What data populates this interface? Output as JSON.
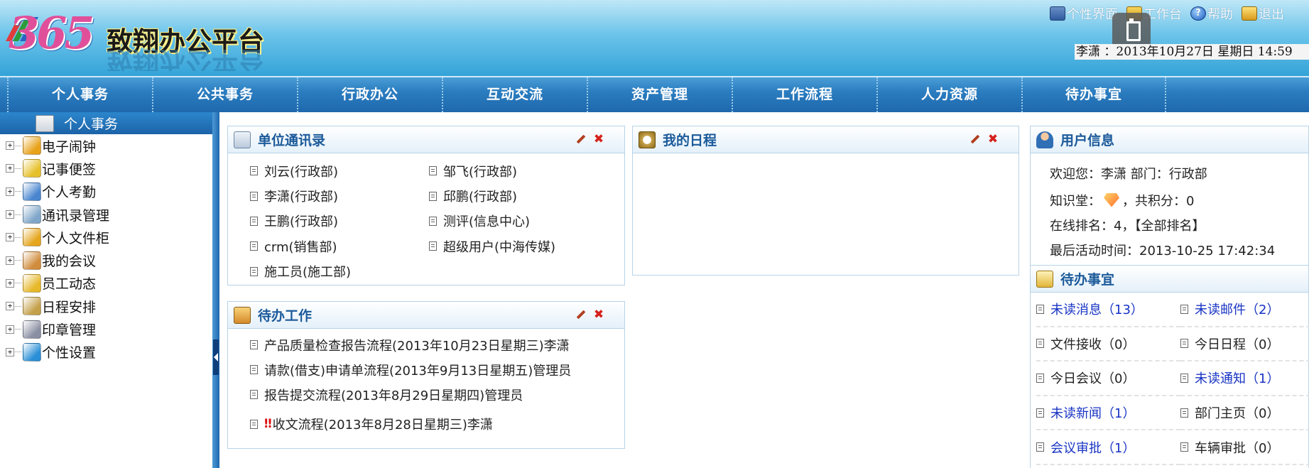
{
  "header": {
    "logo_365": "365",
    "logo_title": "致翔办公平台",
    "toplinks": [
      {
        "label": "个性界面",
        "icon": "personal-ui-icon"
      },
      {
        "label": "工作台",
        "icon": "workbench-icon"
      },
      {
        "label": "帮助",
        "icon": "help-icon"
      },
      {
        "label": "退出",
        "icon": "exit-icon"
      }
    ],
    "user_date": "李潇 ：2013年10月27日  星期日  14:59"
  },
  "menu": [
    "个人事务",
    "公共事务",
    "行政办公",
    "互动交流",
    "资产管理",
    "工作流程",
    "人力资源",
    "待办事宜"
  ],
  "sidebar": {
    "title": "个人事务",
    "items": [
      {
        "label": "电子闹钟",
        "icon": "alarm-bell-icon",
        "color": "#e8a21a"
      },
      {
        "label": "记事便签",
        "icon": "note-pencil-icon",
        "color": "#e6c02a"
      },
      {
        "label": "个人考勤",
        "icon": "calendar-grid-icon",
        "color": "#4a86d0"
      },
      {
        "label": "通讯录管理",
        "icon": "address-book-icon",
        "color": "#7fa6c9"
      },
      {
        "label": "个人文件柜",
        "icon": "file-cabinet-icon",
        "color": "#e5a51c"
      },
      {
        "label": "我的会议",
        "icon": "meeting-icon",
        "color": "#d08c3c"
      },
      {
        "label": "员工动态",
        "icon": "staff-news-icon",
        "color": "#e6b82a"
      },
      {
        "label": "日程安排",
        "icon": "schedule-clock-icon",
        "color": "#c4a04a"
      },
      {
        "label": "印章管理",
        "icon": "seal-icon",
        "color": "#8b8fa3"
      },
      {
        "label": "个性设置",
        "icon": "settings-gear-icon",
        "color": "#2a8fd6"
      }
    ]
  },
  "contacts_panel": {
    "title": "单位通讯录",
    "items": [
      "刘云(行政部)",
      "邹飞(行政部)",
      "李潇(行政部)",
      "邱鹏(行政部)",
      "王鹏(行政部)",
      "测评(信息中心)",
      "crm(销售部)",
      "超级用户(中海传媒)",
      "施工员(施工部)"
    ]
  },
  "schedule_panel": {
    "title": "我的日程"
  },
  "todo_panel": {
    "title": "待办工作",
    "items": [
      {
        "text": "产品质量检查报告流程(2013年10月23日星期三)李潇",
        "urgent": false
      },
      {
        "text": "请款(借支)申请单流程(2013年9月13日星期五)管理员",
        "urgent": false
      },
      {
        "text": "报告提交流程(2013年8月29日星期四)管理员",
        "urgent": false
      },
      {
        "text": "收文流程(2013年8月28日星期三)李潇",
        "urgent": true
      }
    ]
  },
  "user_panel": {
    "title": "用户信息",
    "welcome": "欢迎您：李潇     部门：行政部",
    "knowledge_label": "知识堂：",
    "knowledge_suffix": "，共积分：0",
    "rank": "在线排名：4，【全部排名】",
    "last_active": "最后活动时间：2013-10-25 17:42:34"
  },
  "pending_panel": {
    "title": "待办事宜",
    "items": [
      {
        "label": "未读消息（13）",
        "link": true
      },
      {
        "label": "未读邮件（2）",
        "link": true
      },
      {
        "label": "文件接收（0）",
        "link": false
      },
      {
        "label": "今日日程（0）",
        "link": false
      },
      {
        "label": "今日会议（0）",
        "link": false
      },
      {
        "label": "未读通知（1）",
        "link": true
      },
      {
        "label": "未读新闻（1）",
        "link": true
      },
      {
        "label": "部门主页（0）",
        "link": false
      },
      {
        "label": "会议审批（1）",
        "link": true
      },
      {
        "label": "车辆审批（0）",
        "link": false
      }
    ]
  }
}
